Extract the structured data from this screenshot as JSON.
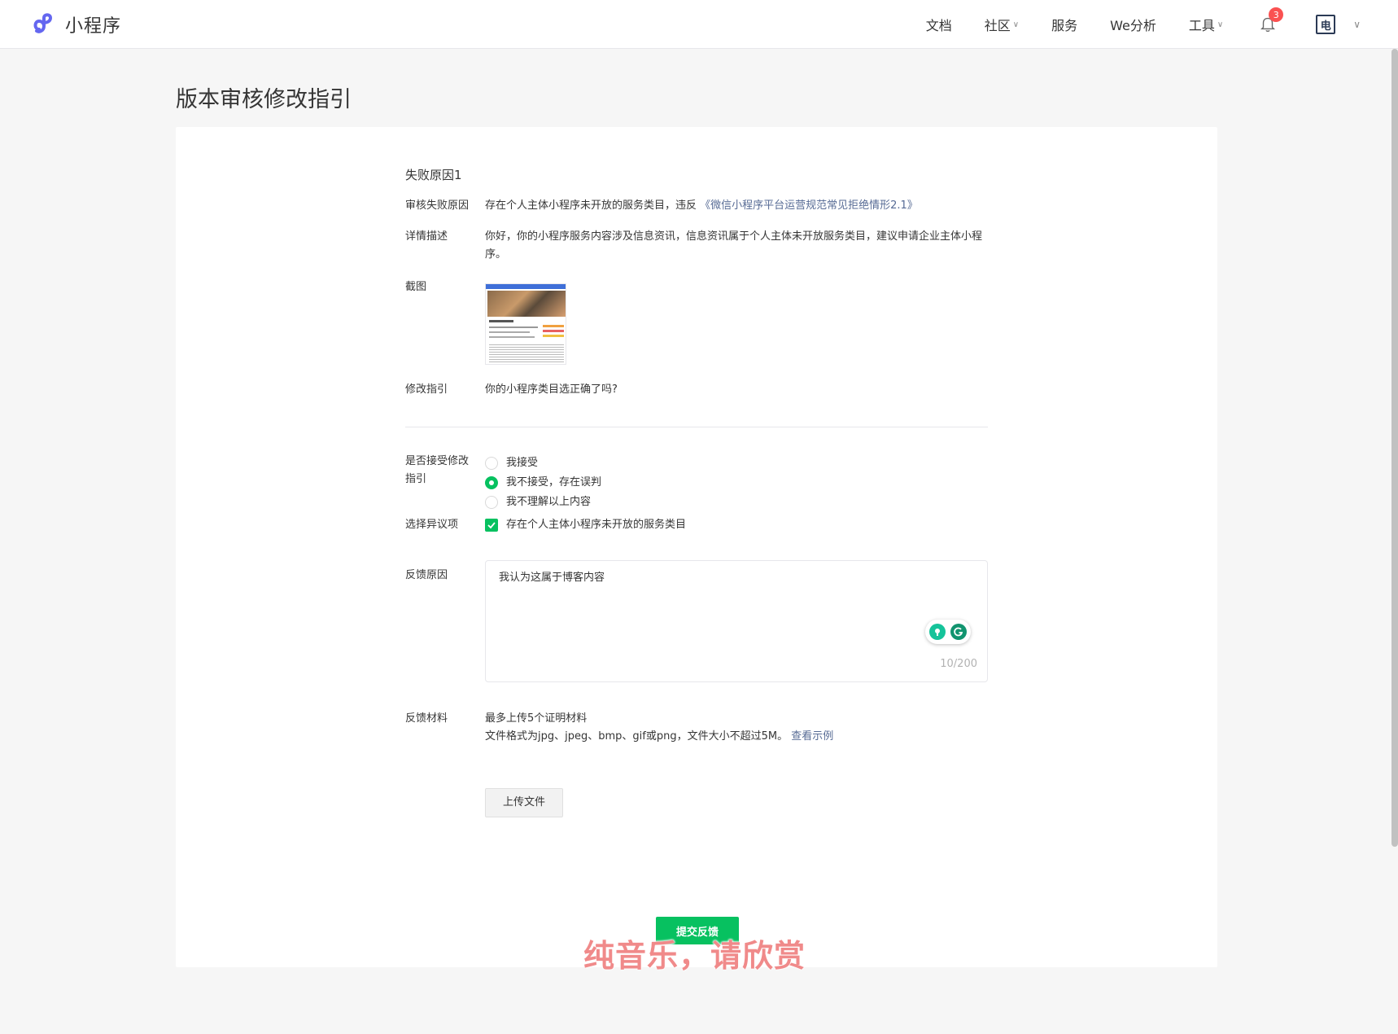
{
  "app": {
    "name": "小程序"
  },
  "nav": {
    "docs": "文档",
    "community": "社区",
    "services": "服务",
    "analytics": "We分析",
    "tools": "工具",
    "notification_count": "3",
    "avatar_char": "电"
  },
  "page": {
    "title": "版本审核修改指引"
  },
  "failure": {
    "section_title": "失败原因1",
    "reason_label": "审核失败原因",
    "reason_text": "存在个人主体小程序未开放的服务类目，违反",
    "reason_link": "《微信小程序平台运营规范常见拒绝情形2.1》",
    "detail_label": "详情描述",
    "detail_text": "你好，你的小程序服务内容涉及信息资讯，信息资讯属于个人主体未开放服务类目，建议申请企业主体小程序。",
    "screenshot_label": "截图",
    "guide_label": "修改指引",
    "guide_link": "你的小程序类目选正确了吗?"
  },
  "form": {
    "accept_label_1": "是否接受修改",
    "accept_label_2": "指引",
    "options": [
      {
        "label": "我接受",
        "selected": false
      },
      {
        "label": "我不接受，存在误判",
        "selected": true
      },
      {
        "label": "我不理解以上内容",
        "selected": false
      }
    ],
    "objection_label": "选择异议项",
    "objection_item": "存在个人主体小程序未开放的服务类目",
    "feedback_label": "反馈原因",
    "feedback_text": "我认为这属于博客内容",
    "feedback_counter": "10/200",
    "material_label": "反馈材料",
    "material_hint_1": "最多上传5个证明材料",
    "material_hint_2": "文件格式为jpg、jpeg、bmp、gif或png，文件大小不超过5M。",
    "example_link": "查看示例",
    "upload_button": "上传文件",
    "submit_button": "提交反馈"
  },
  "overlay": {
    "watermark": "纯音乐，请欣赏"
  },
  "colors": {
    "brand_green": "#07c160",
    "link_blue": "#576b95",
    "badge_red": "#fa5151"
  }
}
